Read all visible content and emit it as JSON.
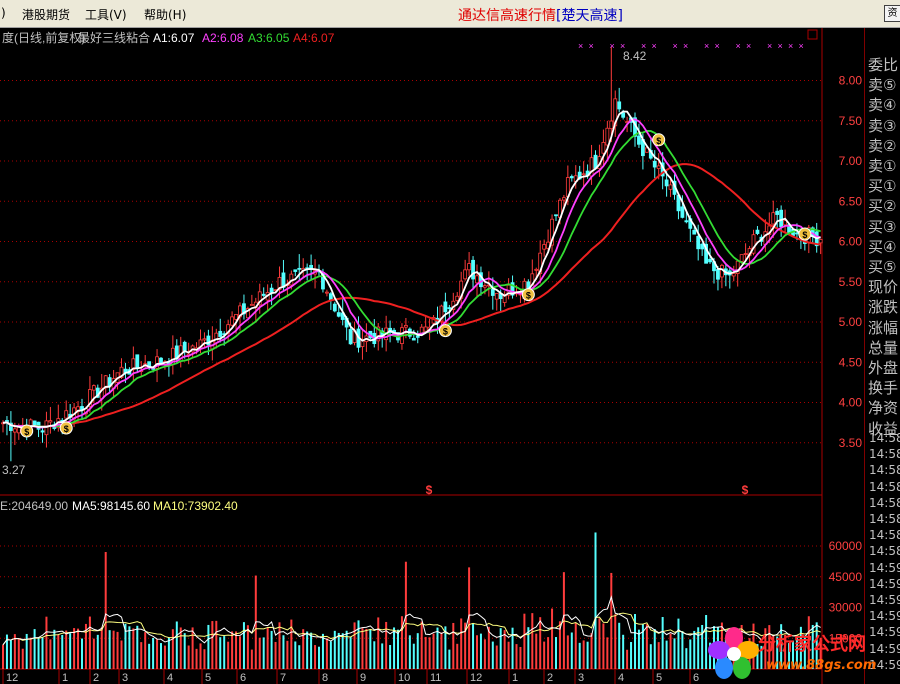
{
  "menubar": {
    "items": [
      "港股期货",
      "工具(V)",
      "帮助(H)"
    ],
    "left_fragment": ")",
    "title": "通达信高速行情",
    "server": "[楚天高速]",
    "window_button": "资"
  },
  "price_panel": {
    "header": {
      "period": "度(日线,前复权)",
      "indicator": "最好三线粘合",
      "a1": "A1:6.07",
      "a2": "A2:6.08",
      "a3": "A3:6.05",
      "a4": "A4:6.07"
    },
    "high_label": "8.42",
    "low_label": "3.27",
    "signal_marker": "$"
  },
  "volume_panel": {
    "header": {
      "vol": "E:204649.00",
      "ma5": "MA5:98145.60",
      "ma10": "MA10:73902.40"
    }
  },
  "colors": {
    "up": "#ff3c3c",
    "down": "#54ffff",
    "a1_line": "#ffffff",
    "a2_line": "#ff40ff",
    "a3_line": "#33dd33",
    "a4_line": "#ee2020",
    "axis": "#aa0000",
    "vol_ma5": "#ffffff",
    "vol_ma10": "#ffff80"
  },
  "chart_data": {
    "type": "candlestick",
    "price_axis": {
      "ticks": [
        3.5,
        4.0,
        4.5,
        5.0,
        5.5,
        6.0,
        6.5,
        7.0,
        7.5,
        8.0
      ],
      "ylim": [
        3.0,
        8.6
      ]
    },
    "volume_axis": {
      "ticks": [
        15000,
        30000,
        45000,
        60000
      ],
      "ylim": [
        0,
        75000
      ]
    },
    "month_labels": [
      "12",
      "1",
      "2",
      "3",
      "4",
      "5",
      "6",
      "7",
      "8",
      "9",
      "10",
      "11",
      "12",
      "1",
      "2",
      "3",
      "4",
      "5",
      "6"
    ],
    "close_keypoints": [
      [
        0,
        3.75
      ],
      [
        10,
        3.68
      ],
      [
        20,
        3.98
      ],
      [
        30,
        4.4
      ],
      [
        40,
        4.52
      ],
      [
        50,
        4.72
      ],
      [
        60,
        5.1
      ],
      [
        70,
        5.5
      ],
      [
        80,
        5.62
      ],
      [
        88,
        4.78
      ],
      [
        98,
        4.85
      ],
      [
        108,
        4.9
      ],
      [
        118,
        5.65
      ],
      [
        126,
        5.35
      ],
      [
        133,
        5.5
      ],
      [
        143,
        6.7
      ],
      [
        150,
        7.0
      ],
      [
        155,
        7.75
      ],
      [
        160,
        7.3
      ],
      [
        168,
        6.7
      ],
      [
        173,
        6.2
      ],
      [
        178,
        5.7
      ],
      [
        184,
        5.55
      ],
      [
        190,
        6.0
      ],
      [
        196,
        6.3
      ],
      [
        201,
        6.1
      ],
      [
        206,
        6.05
      ]
    ],
    "high_point": {
      "index": 154,
      "value": 8.42
    },
    "low_point": {
      "index": 2,
      "value": 3.27
    },
    "buy_marker_indices": [
      6,
      16,
      112,
      133,
      166,
      203
    ],
    "sell_marker_indices": [
      108,
      188
    ]
  },
  "side_panel": {
    "quote_labels": [
      "委比",
      "卖⑤",
      "卖④",
      "卖③",
      "卖②",
      "卖①",
      "买①",
      "买②",
      "买③",
      "买④",
      "买⑤",
      "现价",
      "涨跌",
      "涨幅",
      "总量",
      "外盘",
      "换手",
      "净资",
      "收益"
    ],
    "tick_times": [
      "14:58",
      "14:58",
      "14:58",
      "14:58",
      "14:58",
      "14:58",
      "14:58",
      "14:58",
      "14:59",
      "14:59",
      "14:59",
      "14:59",
      "14:59",
      "14:59",
      "14:59"
    ]
  },
  "watermark": {
    "title": "分析家公式网",
    "url": "www.88gs.com"
  }
}
